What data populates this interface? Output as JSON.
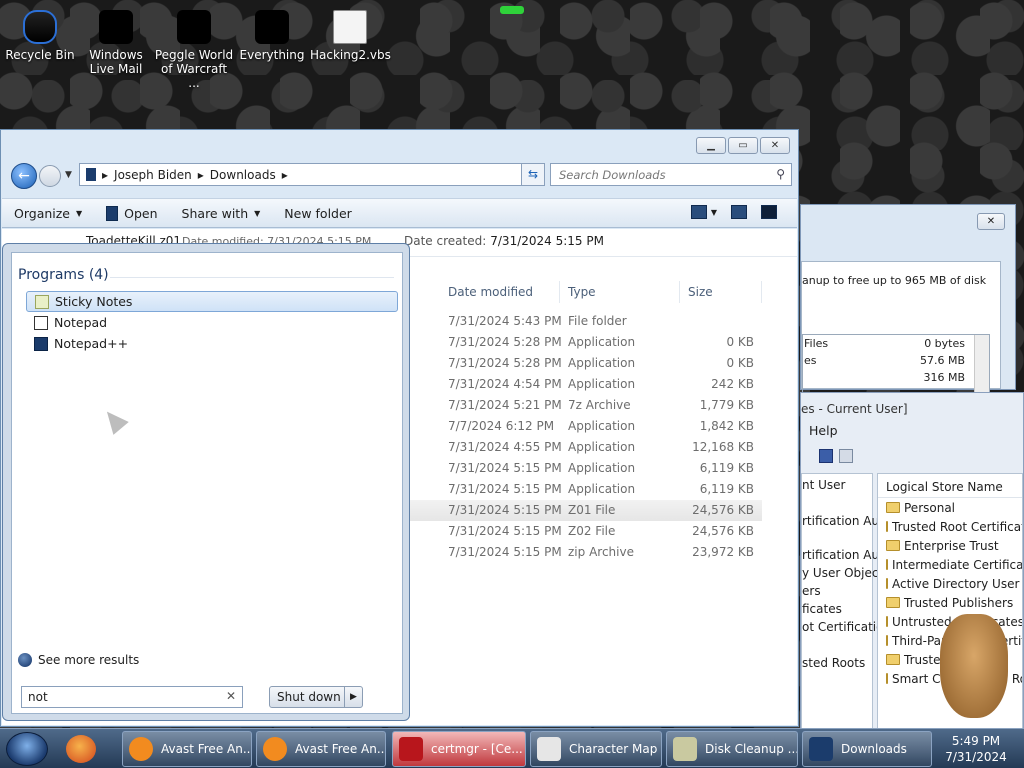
{
  "desktop": {
    "icons": [
      {
        "label": "Recycle Bin",
        "icon": "recycle-bin-icon"
      },
      {
        "label": "Windows Live Mail",
        "icon": "mail-icon"
      },
      {
        "label": "Peggle World of Warcraft ...",
        "icon": "peggle-icon"
      },
      {
        "label": "Everything",
        "icon": "everything-icon"
      },
      {
        "label": "Hacking2.vbs",
        "icon": "script-icon"
      }
    ]
  },
  "explorer": {
    "breadcrumb": [
      "Joseph Biden",
      "Downloads"
    ],
    "search_placeholder": "Search Downloads",
    "toolbar": {
      "organize": "Organize",
      "open": "Open",
      "share_with": "Share with",
      "new_folder": "New folder"
    },
    "details": {
      "name": "ToadetteKill.z01",
      "date_modified_label": "Date modified:",
      "date_modified": "7/31/2024 5:15 PM",
      "date_created_label": "Date created:",
      "date_created": "7/31/2024 5:15 PM"
    },
    "columns": {
      "date": "Date modified",
      "type": "Type",
      "size": "Size"
    },
    "rows": [
      {
        "date": "7/31/2024 5:43 PM",
        "type": "File folder",
        "size": ""
      },
      {
        "date": "7/31/2024 5:28 PM",
        "type": "Application",
        "size": "0 KB"
      },
      {
        "date": "7/31/2024 5:28 PM",
        "type": "Application",
        "size": "0 KB"
      },
      {
        "date": "7/31/2024 4:54 PM",
        "type": "Application",
        "size": "242 KB"
      },
      {
        "date": "7/31/2024 5:21 PM",
        "type": "7z Archive",
        "size": "1,779 KB"
      },
      {
        "date": "7/7/2024 6:12 PM",
        "type": "Application",
        "size": "1,842 KB"
      },
      {
        "date": "7/31/2024 4:55 PM",
        "type": "Application",
        "size": "12,168 KB"
      },
      {
        "date": "7/31/2024 5:15 PM",
        "type": "Application",
        "size": "6,119 KB"
      },
      {
        "date": "7/31/2024 5:15 PM",
        "type": "Application",
        "size": "6,119 KB"
      },
      {
        "date": "7/31/2024 5:15 PM",
        "type": "Z01 File",
        "size": "24,576 KB"
      },
      {
        "date": "7/31/2024 5:15 PM",
        "type": "Z02 File",
        "size": "24,576 KB"
      },
      {
        "date": "7/31/2024 5:15 PM",
        "type": "zip Archive",
        "size": "23,972 KB"
      }
    ]
  },
  "start_menu": {
    "programs_heading": "Programs (4)",
    "programs": [
      "Sticky Notes",
      "Notepad",
      "Notepad++"
    ],
    "see_more": "See more results",
    "search_value": "not",
    "shutdown_label": "Shut down"
  },
  "disk_cleanup": {
    "description": "anup to free up to 965 MB of disk",
    "rows": [
      {
        "name": "Files",
        "size": "0 bytes"
      },
      {
        "name": "es",
        "size": "57.6 MB"
      },
      {
        "name": "",
        "size": "316 MB"
      }
    ]
  },
  "certmgr": {
    "title": "es - Current User]",
    "menu_help": "Help",
    "left_items": [
      "nt User",
      "rtification Au",
      "rtification Au",
      "y User Object",
      "ers",
      "ficates",
      "ot Certification",
      "sted Roots"
    ],
    "right_header": "Logical Store Name",
    "stores": [
      "Personal",
      "Trusted Root Certificatio",
      "Enterprise Trust",
      "Intermediate Certificatio",
      "Active Directory User Ob",
      "Trusted Publishers",
      "Untrusted Certificates",
      "Third-Party Root Certific",
      "Trusted People",
      "Smart Card Trusted Roo"
    ]
  },
  "taskbar": {
    "tasks": [
      {
        "label": "Avast Free An...",
        "icon": "avast-icon"
      },
      {
        "label": "Avast Free An...",
        "icon": "avast-icon"
      },
      {
        "label": "certmgr - [Ce...",
        "icon": "toolbox-icon"
      },
      {
        "label": "Character Map",
        "icon": "character-map-icon"
      },
      {
        "label": "Disk Cleanup ...",
        "icon": "disk-cleanup-icon"
      },
      {
        "label": "Downloads",
        "icon": "folder-icon"
      }
    ],
    "time": "5:49 PM",
    "date": "7/31/2024"
  },
  "colors": {
    "accent": "#1a5fb4",
    "taskbar": "#243a55"
  }
}
